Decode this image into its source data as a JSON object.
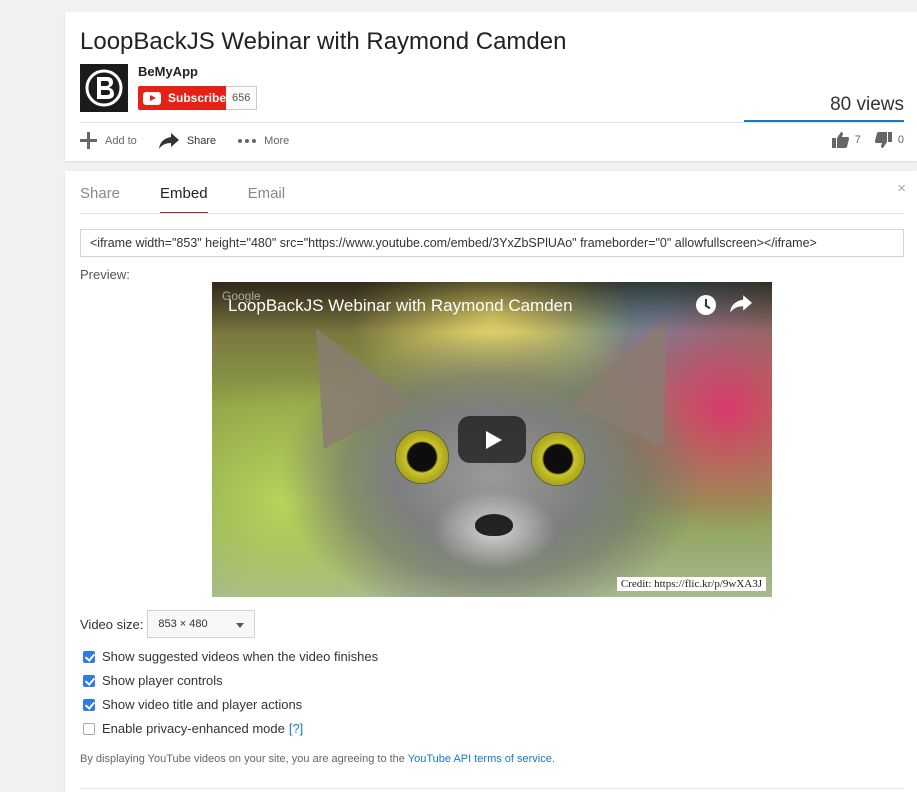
{
  "video": {
    "title": "LoopBackJS Webinar with Raymond Camden",
    "views": "80 views"
  },
  "channel": {
    "name": "BeMyApp",
    "subscribe_label": "Subscribe",
    "subscriber_count": "656"
  },
  "actions": {
    "add_to": "Add to",
    "share": "Share",
    "more": "More",
    "likes": "7",
    "dislikes": "0"
  },
  "share_panel": {
    "tabs": [
      "Share",
      "Embed",
      "Email"
    ],
    "active_tab": "Embed",
    "close": "×",
    "embed_code": "<iframe width=\"853\" height=\"480\" src=\"https://www.youtube.com/embed/3YxZbSPlUAo\" frameborder=\"0\" allowfullscreen></iframe>",
    "preview_label": "Preview:",
    "player": {
      "title": "LoopBackJS Webinar with Raymond Camden",
      "watermark": "Google",
      "credit": "Credit: https://flic.kr/p/9wXA3J"
    },
    "video_size_label": "Video size:",
    "video_size_value": "853 × 480",
    "options": [
      {
        "label": "Show suggested videos when the video finishes",
        "checked": true
      },
      {
        "label": "Show player controls",
        "checked": true
      },
      {
        "label": "Show video title and player actions",
        "checked": true
      },
      {
        "label": "Enable privacy-enhanced mode",
        "checked": false
      }
    ],
    "help_link": "[?]",
    "terms_text": "By displaying YouTube videos on your site, you are agreeing to the",
    "terms_link": "YouTube API terms of service",
    "terms_end": "."
  },
  "colors": {
    "subscribe_red": "#e62117",
    "link_blue": "#167ac6",
    "checkbox_blue": "#2b7de1",
    "tab_underline": "#cc181e"
  }
}
